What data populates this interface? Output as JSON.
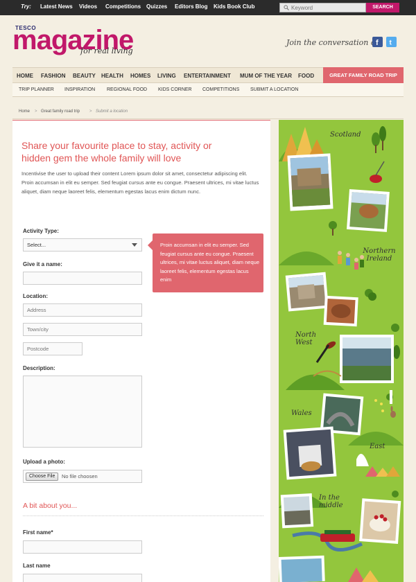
{
  "topbar": {
    "try_label": "Try:",
    "links": [
      "Latest News",
      "Videos",
      "Competitions",
      "Quizzes",
      "Editors Blog",
      "Kids Book Club"
    ],
    "search_placeholder": "Keyword",
    "search_button": "SEARCH"
  },
  "logo": {
    "brand": "TESCO",
    "title": "magazine",
    "tagline": "for real living"
  },
  "social": {
    "text": "Join the conversation on",
    "facebook_color": "#3b5998",
    "twitter_color": "#55acee"
  },
  "nav_primary": [
    "HOME",
    "FASHION",
    "BEAUTY",
    "HEALTH",
    "HOMES",
    "LIVING",
    "ENTERTAINMENT",
    "MUM OF THE YEAR",
    "FOOD"
  ],
  "nav_feature": "GREAT FAMILY ROAD TRIP",
  "nav_secondary": [
    "TRIP PLANNER",
    "INSPIRATION",
    "REGIONAL FOOD",
    "KIDS CORNER",
    "COMPETITIONS",
    "SUBMIT A LOCATION"
  ],
  "breadcrumb": {
    "items": [
      "Home",
      "Great family road trip"
    ],
    "current": "Submit a location",
    "separator": ">"
  },
  "form": {
    "heading": "Share your favourite place to stay, activity or hidden gem the whole family will love",
    "intro": "Incentivise the user to upload their content Lorem ipsum dolor sit amet, consectetur adipiscing elit. Proin accumsan in elit eu semper. Sed feugiat cursus ante eu congue. Praesent ultrices, mi vitae luctus aliquet, diam neque laoreet felis, elementum egestas lacus enim dictum nunc.",
    "activity_label": "Activity Type:",
    "activity_value": "Select...",
    "name_label": "Give it a name:",
    "location_label": "Location:",
    "address_placeholder": "Address",
    "town_placeholder": "Town/city",
    "postcode_placeholder": "Postcode",
    "description_label": "Description:",
    "upload_label": "Upload a photo:",
    "file_button": "Choose File",
    "file_status": "No file choosen",
    "about_heading": "A bit about you...",
    "first_name_label": "First name*",
    "last_name_label": "Last name"
  },
  "tooltip": "Proin accumsan in elit eu semper. Sed feugiat cursus ante eu congue. Praesent ultrices, mi vitae luctus aliquet, diam neque laoreet felis, elementum egestas lacus enim",
  "map": {
    "regions": [
      "Scotland",
      "Northern Ireland",
      "North West",
      "Wales",
      "East",
      "In the middle"
    ],
    "background": "#93c63d"
  },
  "colors": {
    "accent": "#c1186a",
    "coral": "#e0666e",
    "heading": "#e05555",
    "topbar": "#2b2b2b"
  }
}
